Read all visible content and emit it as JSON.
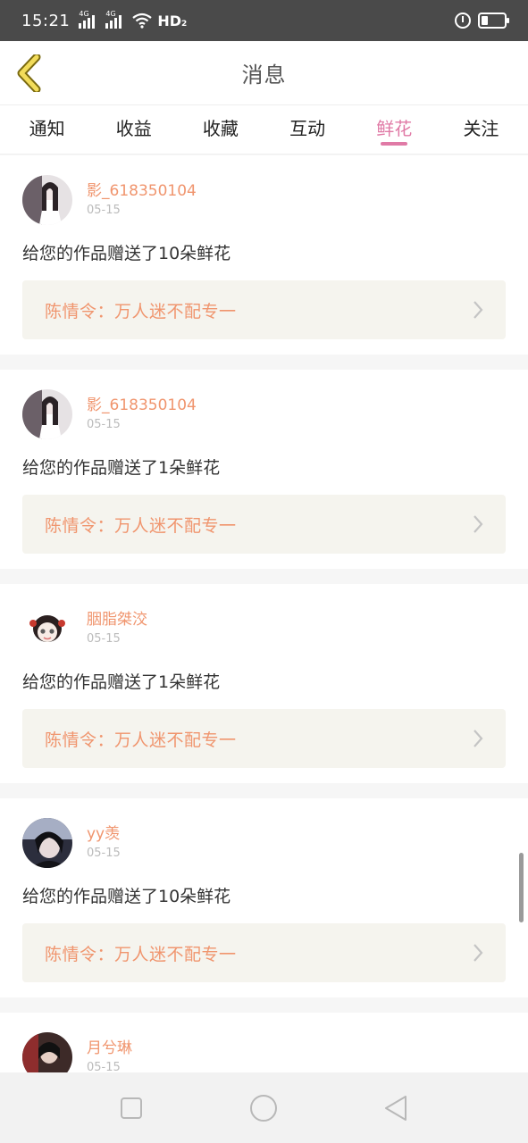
{
  "status_bar": {
    "time": "15:21",
    "network_1": "4G",
    "network_2": "4G",
    "hd_label": "HD",
    "hd_sub": "2",
    "battery_level": 0.3
  },
  "header": {
    "title": "消息",
    "back_icon": "chevron-left-icon"
  },
  "tabs": [
    {
      "label": "通知",
      "active": false
    },
    {
      "label": "收益",
      "active": false
    },
    {
      "label": "收藏",
      "active": false
    },
    {
      "label": "互动",
      "active": false
    },
    {
      "label": "鲜花",
      "active": true
    },
    {
      "label": "关注",
      "active": false
    }
  ],
  "messages": [
    {
      "username": "影_618350104",
      "date": "05-15",
      "text": "给您的作品赠送了10朵鲜花",
      "work_title": "陈情令：万人迷不配专一"
    },
    {
      "username": "影_618350104",
      "date": "05-15",
      "text": "给您的作品赠送了1朵鲜花",
      "work_title": "陈情令：万人迷不配专一"
    },
    {
      "username": "胭脂桀洨",
      "date": "05-15",
      "text": "给您的作品赠送了1朵鲜花",
      "work_title": "陈情令：万人迷不配专一"
    },
    {
      "username": "yy羡",
      "date": "05-15",
      "text": "给您的作品赠送了10朵鲜花",
      "work_title": "陈情令：万人迷不配专一"
    },
    {
      "username": "月兮琳",
      "date": "05-15",
      "text": "",
      "work_title": ""
    }
  ],
  "colors": {
    "accent_pink": "#e07aa6",
    "username_orange": "#f0956e",
    "work_bg": "#f5f4ee"
  },
  "nav_bar": {
    "icons": [
      "square-recents-icon",
      "circle-home-icon",
      "triangle-back-icon"
    ]
  }
}
